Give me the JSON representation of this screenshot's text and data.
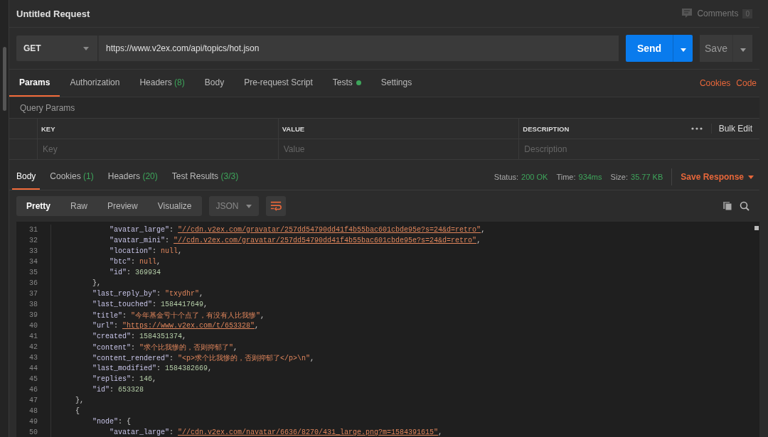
{
  "request": {
    "title": "Untitled Request",
    "comments": {
      "label": "Comments",
      "count": "0"
    }
  },
  "url_bar": {
    "method": "GET",
    "url": "https://www.v2ex.com/api/topics/hot.json",
    "send": "Send",
    "save": "Save"
  },
  "request_tabs": [
    {
      "label": "Params",
      "selected": true,
      "dot": false
    },
    {
      "label": "Authorization",
      "selected": false,
      "dot": false
    },
    {
      "label": "Headers",
      "badge": "(8)",
      "selected": false,
      "dot": false
    },
    {
      "label": "Body",
      "selected": false,
      "dot": false
    },
    {
      "label": "Pre-request Script",
      "selected": false,
      "dot": false
    },
    {
      "label": "Tests",
      "selected": false,
      "dot": true
    },
    {
      "label": "Settings",
      "selected": false,
      "dot": false
    }
  ],
  "request_links": [
    "Cookies",
    "Code"
  ],
  "query_params": {
    "title": "Query Params",
    "columns": [
      "KEY",
      "VALUE",
      "DESCRIPTION"
    ],
    "placeholders": [
      "Key",
      "Value",
      "Description"
    ],
    "bulk_edit": "Bulk Edit"
  },
  "response_tabs": [
    {
      "label": "Body",
      "selected": true
    },
    {
      "label": "Cookies",
      "badge": "(1)",
      "selected": false
    },
    {
      "label": "Headers",
      "badge": "(20)",
      "selected": false
    },
    {
      "label": "Test Results",
      "badge": "(3/3)",
      "selected": false
    }
  ],
  "response_meta": [
    {
      "label": "Status:",
      "value": "200 OK"
    },
    {
      "label": "Time:",
      "value": "934ms"
    },
    {
      "label": "Size:",
      "value": "35.77 KB"
    }
  ],
  "save_response": "Save Response",
  "view_modes": [
    {
      "label": "Pretty",
      "selected": true
    },
    {
      "label": "Raw",
      "selected": false
    },
    {
      "label": "Preview",
      "selected": false
    },
    {
      "label": "Visualize",
      "selected": false
    }
  ],
  "format": "JSON",
  "wrap_lines": true,
  "code_lines": [
    {
      "number": "31",
      "tokens": [
        {
          "kind": "key",
          "text": "            \"avatar_large\""
        },
        {
          "kind": "punct",
          "text": ": "
        },
        {
          "kind": "link",
          "text": "\"//cdn.v2ex.com/gravatar/257dd54790dd41f4b55bac601cbde95e?s=24&d=retro\""
        },
        {
          "kind": "punct",
          "text": ","
        }
      ]
    },
    {
      "number": "32",
      "tokens": [
        {
          "kind": "key",
          "text": "            \"avatar_mini\""
        },
        {
          "kind": "punct",
          "text": ": "
        },
        {
          "kind": "link",
          "text": "\"//cdn.v2ex.com/gravatar/257dd54790dd41f4b55bac601cbde95e?s=24&d=retro\""
        },
        {
          "kind": "punct",
          "text": ","
        }
      ]
    },
    {
      "number": "33",
      "tokens": [
        {
          "kind": "key",
          "text": "            \"location\""
        },
        {
          "kind": "punct",
          "text": ": "
        },
        {
          "kind": "null",
          "text": "null"
        },
        {
          "kind": "punct",
          "text": ","
        }
      ]
    },
    {
      "number": "34",
      "tokens": [
        {
          "kind": "key",
          "text": "            \"btc\""
        },
        {
          "kind": "punct",
          "text": ": "
        },
        {
          "kind": "null",
          "text": "null"
        },
        {
          "kind": "punct",
          "text": ","
        }
      ]
    },
    {
      "number": "35",
      "tokens": [
        {
          "kind": "key",
          "text": "            \"id\""
        },
        {
          "kind": "punct",
          "text": ": "
        },
        {
          "kind": "number",
          "text": "369934"
        }
      ]
    },
    {
      "number": "36",
      "tokens": [
        {
          "kind": "punct",
          "text": "        },"
        }
      ]
    },
    {
      "number": "37",
      "tokens": [
        {
          "kind": "key",
          "text": "        \"last_reply_by\""
        },
        {
          "kind": "punct",
          "text": ": "
        },
        {
          "kind": "string",
          "text": "\"txydhr\""
        },
        {
          "kind": "punct",
          "text": ","
        }
      ]
    },
    {
      "number": "38",
      "tokens": [
        {
          "kind": "key",
          "text": "        \"last_touched\""
        },
        {
          "kind": "punct",
          "text": ": "
        },
        {
          "kind": "number",
          "text": "1584417649"
        },
        {
          "kind": "punct",
          "text": ","
        }
      ]
    },
    {
      "number": "39",
      "tokens": [
        {
          "kind": "key",
          "text": "        \"title\""
        },
        {
          "kind": "punct",
          "text": ": "
        },
        {
          "kind": "string",
          "text": "\"今年基金亏十个点了，有没有人比我惨\""
        },
        {
          "kind": "punct",
          "text": ","
        }
      ]
    },
    {
      "number": "40",
      "tokens": [
        {
          "kind": "key",
          "text": "        \"url\""
        },
        {
          "kind": "punct",
          "text": ": "
        },
        {
          "kind": "link",
          "text": "\"https://www.v2ex.com/t/653328\""
        },
        {
          "kind": "punct",
          "text": ","
        }
      ]
    },
    {
      "number": "41",
      "tokens": [
        {
          "kind": "key",
          "text": "        \"created\""
        },
        {
          "kind": "punct",
          "text": ": "
        },
        {
          "kind": "number",
          "text": "1584351374"
        },
        {
          "kind": "punct",
          "text": ","
        }
      ]
    },
    {
      "number": "42",
      "tokens": [
        {
          "kind": "key",
          "text": "        \"content\""
        },
        {
          "kind": "punct",
          "text": ": "
        },
        {
          "kind": "string",
          "text": "\"求个比我惨的，否则抑郁了\""
        },
        {
          "kind": "punct",
          "text": ","
        }
      ]
    },
    {
      "number": "43",
      "tokens": [
        {
          "kind": "key",
          "text": "        \"content_rendered\""
        },
        {
          "kind": "punct",
          "text": ": "
        },
        {
          "kind": "string",
          "text": "\"<p>求个比我惨的，否则抑郁了</p>\\n\""
        },
        {
          "kind": "punct",
          "text": ","
        }
      ]
    },
    {
      "number": "44",
      "tokens": [
        {
          "kind": "key",
          "text": "        \"last_modified\""
        },
        {
          "kind": "punct",
          "text": ": "
        },
        {
          "kind": "number",
          "text": "1584382669"
        },
        {
          "kind": "punct",
          "text": ","
        }
      ]
    },
    {
      "number": "45",
      "tokens": [
        {
          "kind": "key",
          "text": "        \"replies\""
        },
        {
          "kind": "punct",
          "text": ": "
        },
        {
          "kind": "number",
          "text": "146"
        },
        {
          "kind": "punct",
          "text": ","
        }
      ]
    },
    {
      "number": "46",
      "tokens": [
        {
          "kind": "key",
          "text": "        \"id\""
        },
        {
          "kind": "punct",
          "text": ": "
        },
        {
          "kind": "number",
          "text": "653328"
        }
      ]
    },
    {
      "number": "47",
      "tokens": [
        {
          "kind": "punct",
          "text": "    },"
        }
      ]
    },
    {
      "number": "48",
      "tokens": [
        {
          "kind": "punct",
          "text": "    {"
        }
      ]
    },
    {
      "number": "49",
      "tokens": [
        {
          "kind": "key",
          "text": "        \"node\""
        },
        {
          "kind": "punct",
          "text": ": {"
        }
      ]
    },
    {
      "number": "50",
      "tokens": [
        {
          "kind": "key",
          "text": "            \"avatar_large\""
        },
        {
          "kind": "punct",
          "text": ": "
        },
        {
          "kind": "link",
          "text": "\"//cdn.v2ex.com/navatar/6636/8270/431_large.png?m=1584391615\""
        },
        {
          "kind": "punct",
          "text": ","
        }
      ]
    }
  ]
}
